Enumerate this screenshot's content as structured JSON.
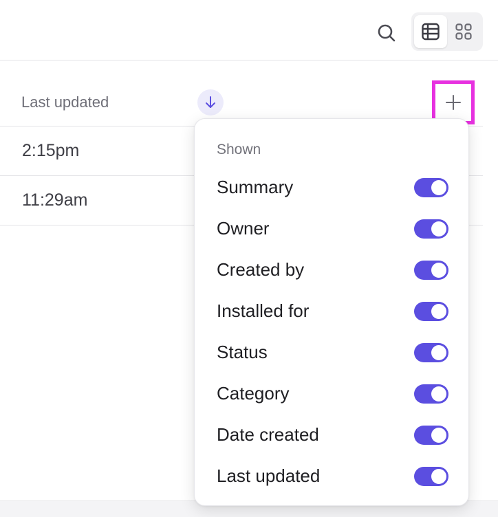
{
  "header": {
    "search_icon": "search-icon",
    "view_table_icon": "table-icon",
    "view_grid_icon": "grid-icon"
  },
  "column_header": {
    "label": "Last updated",
    "sort_icon": "arrow-down-icon",
    "add_icon": "plus-icon"
  },
  "rows": [
    {
      "last_updated": "2:15pm"
    },
    {
      "last_updated": "11:29am"
    }
  ],
  "dropdown": {
    "heading": "Shown",
    "items": [
      {
        "label": "Summary",
        "enabled": true
      },
      {
        "label": "Owner",
        "enabled": true
      },
      {
        "label": "Created by",
        "enabled": true
      },
      {
        "label": "Installed for",
        "enabled": true
      },
      {
        "label": "Status",
        "enabled": true
      },
      {
        "label": "Category",
        "enabled": true
      },
      {
        "label": "Date created",
        "enabled": true
      },
      {
        "label": "Last updated",
        "enabled": true
      }
    ]
  },
  "colors": {
    "accent": "#5b4ee0",
    "highlight_border": "#e731e0"
  }
}
